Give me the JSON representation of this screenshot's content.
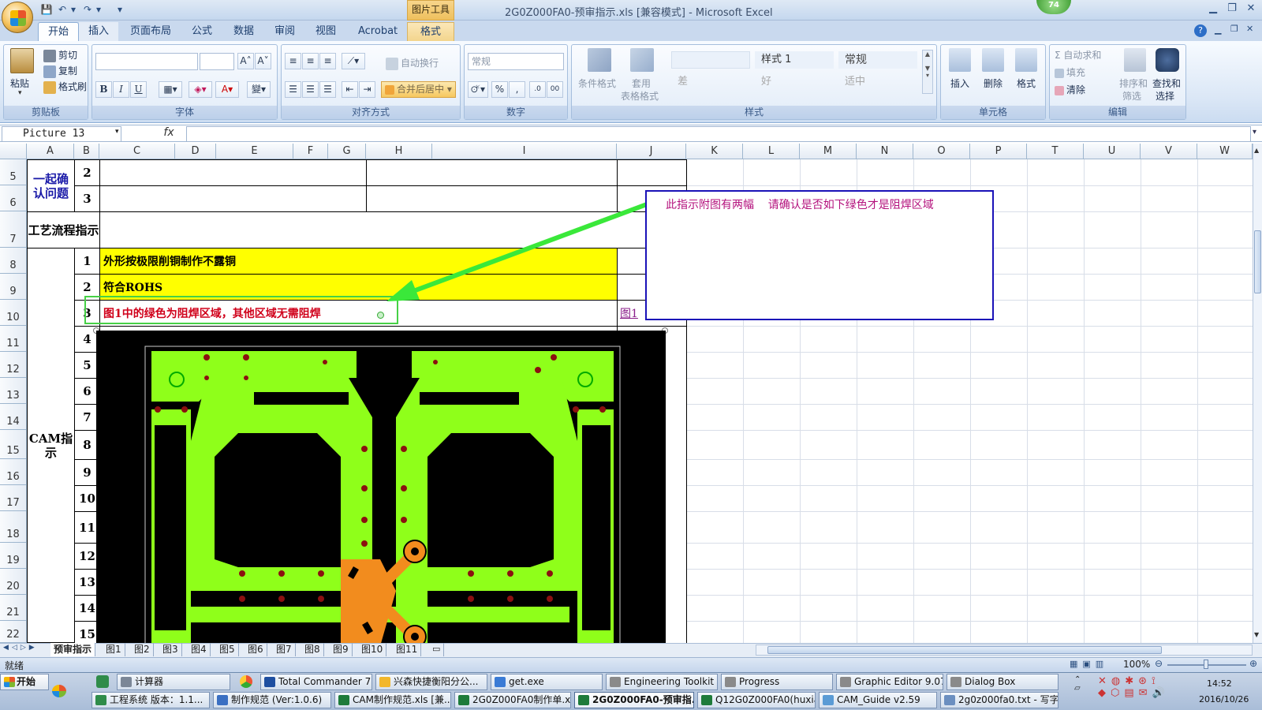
{
  "title": {
    "window": "2G0Z000FA0-预审指示.xls [兼容模式] - Microsoft Excel",
    "tool_tab_caption": "图片工具",
    "badge": "74",
    "qat": [
      "💾",
      "↶",
      "▾",
      "↷",
      "▾",
      "▾"
    ]
  },
  "tabs": [
    "开始",
    "插入",
    "页面布局",
    "公式",
    "数据",
    "审阅",
    "视图",
    "Acrobat",
    "格式"
  ],
  "ribbon": {
    "clipboard": {
      "label": "剪贴板",
      "paste": "粘贴",
      "cut": "剪切",
      "copy": "复制",
      "format_painter": "格式刷"
    },
    "font": {
      "label": "字体",
      "grow": "A˄",
      "shrink": "A˅",
      "bold": "B",
      "italic": "I",
      "underline": "U"
    },
    "alignment": {
      "label": "对齐方式",
      "wrap": "自动换行",
      "merge": "合并后居中"
    },
    "number": {
      "label": "数字",
      "format": "常规",
      "percent": "%",
      "comma": ",",
      "inc": ".0",
      "dec": "00"
    },
    "styles": {
      "label": "样式",
      "conditional": "条件格式",
      "table": "套用",
      "table2": "表格格式",
      "cells": [
        {
          "name": "样式 1"
        },
        {
          "name": "常规"
        },
        {
          "name": "差"
        },
        {
          "name": "好"
        },
        {
          "name": "适中"
        }
      ]
    },
    "cells": {
      "label": "单元格",
      "insert": "插入",
      "delete": "删除",
      "format": "格式"
    },
    "editing": {
      "label": "编辑",
      "autosum": "自动求和",
      "fill": "填充",
      "clear": "清除",
      "sort": "排序和",
      "sort2": "筛选",
      "find": "查找和",
      "find2": "选择"
    }
  },
  "formula": {
    "namebox": "Picture 13",
    "fx": "fx"
  },
  "columns": [
    "A",
    "B",
    "C",
    "D",
    "E",
    "F",
    "G",
    "H",
    "I",
    "J",
    "K",
    "L",
    "M",
    "N",
    "O",
    "P",
    "T",
    "U",
    "V",
    "W"
  ],
  "rows": [
    "5",
    "6",
    "7",
    "8",
    "9",
    "10",
    "11",
    "12",
    "13",
    "14",
    "15",
    "16",
    "17",
    "18",
    "19",
    "20",
    "21",
    "22"
  ],
  "cells": {
    "a5": "一起确认问题",
    "b5": "2",
    "b6": "3",
    "a7": "工艺流程指示",
    "b8": "1",
    "c8": "外形按极限削铜制作不露铜",
    "b9": "2",
    "c9": "符合ROHS",
    "b10": "3",
    "c10": "图1中的绿色为阻焊区域，其他区域无需阻焊",
    "j10": "图1",
    "a_cam": "CAM指示",
    "nums": [
      "4",
      "5",
      "6",
      "7",
      "8",
      "9",
      "10",
      "11",
      "12",
      "13",
      "14",
      "15"
    ]
  },
  "callout": {
    "text": "此指示附图有两幅    请确认是否如下绿色才是阻焊区域"
  },
  "sheet_tabs": [
    "预审指示",
    "图1",
    "图2",
    "图3",
    "图4",
    "图5",
    "图6",
    "图7",
    "图8",
    "图9",
    "图10",
    "图11"
  ],
  "status": {
    "ready": "就绪",
    "zoom": "100%"
  },
  "taskbar": {
    "start": "开始",
    "row1": [
      "计算器",
      "Total Commander 7.0...",
      "兴森快捷衡阳分公...",
      "get.exe",
      "Engineering Toolkit 9....",
      "Progress",
      "Graphic Editor 9.07b...",
      "Dialog Box"
    ],
    "row2": [
      "工程系统  版本：1.1...",
      "制作规范 (Ver:1.0.6)",
      "CAM制作规范.xls [兼...",
      "2G0Z000FA0制作单.xl...",
      "2G0Z000FA0-预审指...",
      "Q12G0Z000FA0(huxian...",
      "CAM_Guide v2.59",
      "2g0z000fa0.txt - 写字板"
    ],
    "time": "14:52",
    "date": "2016/10/26"
  },
  "colors": {
    "pcb_green": "#8fff1a",
    "pcb_orange": "#f28c1e",
    "callout_border": "#1a12b8",
    "arrow": "#3ae83a",
    "yellow": "#ffff00",
    "red_text": "#d0001a",
    "blue_text": "#1a1aa8"
  }
}
